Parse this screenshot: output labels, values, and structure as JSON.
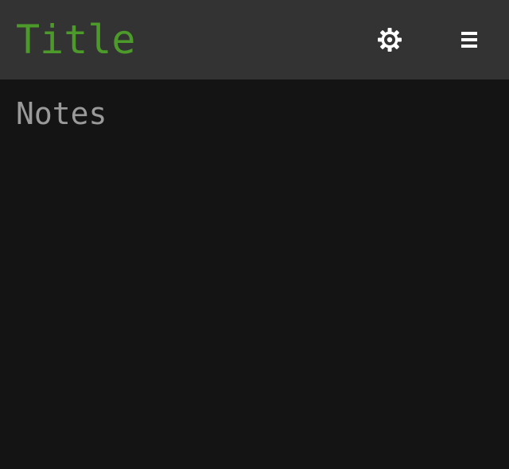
{
  "header": {
    "title": "Title",
    "settings_icon": "gear-icon",
    "menu_icon": "hamburger-menu-icon"
  },
  "notes": {
    "placeholder": "Notes",
    "value": ""
  },
  "colors": {
    "header_background": "#333333",
    "page_background": "#141414",
    "title_color": "#4c9a2a",
    "placeholder_color": "#9a9a9a",
    "icon_color": "#ffffff"
  }
}
